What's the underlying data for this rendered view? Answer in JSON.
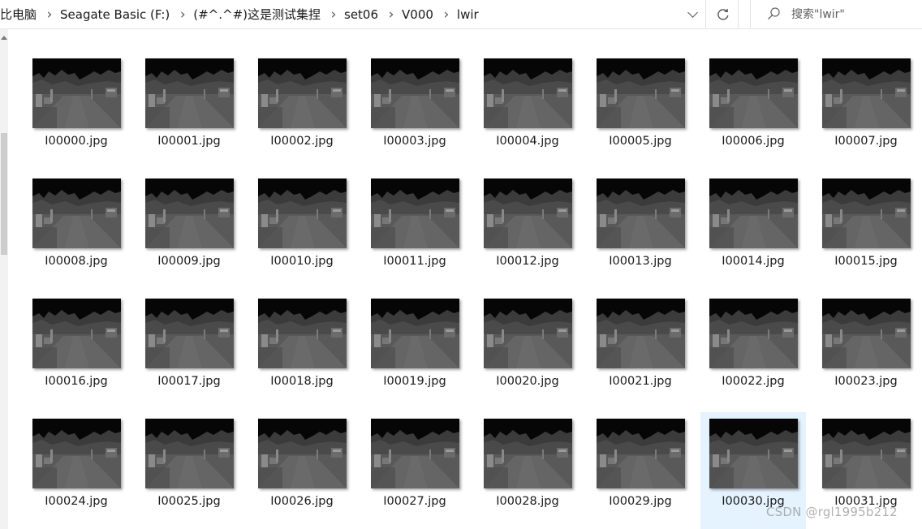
{
  "breadcrumb": [
    "比电脑",
    "Seagate Basic (F:)",
    "(#^.^#)这是测试集捏",
    "set06",
    "V000",
    "lwir"
  ],
  "search": {
    "placeholder": "搜索\"lwir\""
  },
  "files": [
    "I00000.jpg",
    "I00001.jpg",
    "I00002.jpg",
    "I00003.jpg",
    "I00004.jpg",
    "I00005.jpg",
    "I00006.jpg",
    "I00007.jpg",
    "I00008.jpg",
    "I00009.jpg",
    "I00010.jpg",
    "I00011.jpg",
    "I00012.jpg",
    "I00013.jpg",
    "I00014.jpg",
    "I00015.jpg",
    "I00016.jpg",
    "I00017.jpg",
    "I00018.jpg",
    "I00019.jpg",
    "I00020.jpg",
    "I00021.jpg",
    "I00022.jpg",
    "I00023.jpg",
    "I00024.jpg",
    "I00025.jpg",
    "I00026.jpg",
    "I00027.jpg",
    "I00028.jpg",
    "I00029.jpg",
    "I00030.jpg",
    "I00031.jpg"
  ],
  "selected_file": "I00030.jpg",
  "watermark": "CSDN @rgl1995b212",
  "colors": {
    "selection": "#e5f3ff",
    "text": "#1a1a1a"
  },
  "icons": {
    "dropdown": "chevron-down-icon",
    "refresh": "refresh-icon",
    "search": "search-icon"
  }
}
